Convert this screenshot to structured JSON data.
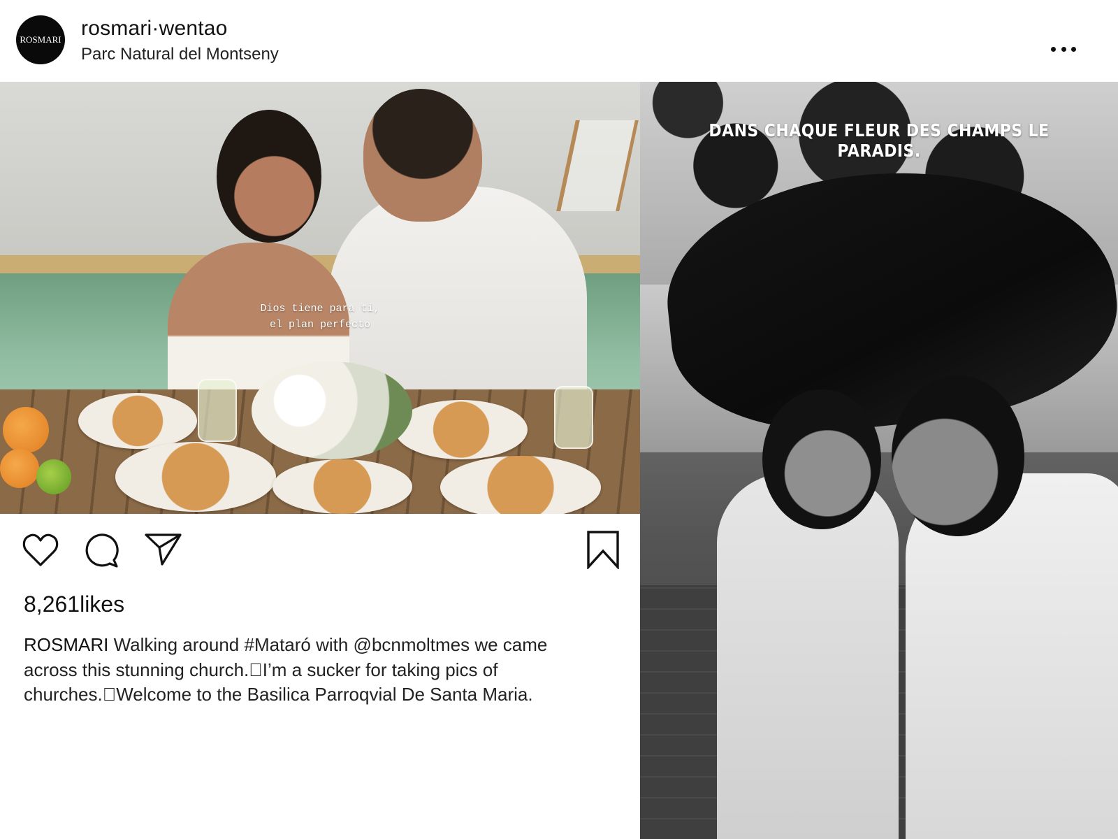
{
  "header": {
    "avatar_text": "ROSMARI",
    "username": "rosmari·wentao",
    "location": "Parc Natural del Montseny",
    "more_icon": "more-horizontal-icon"
  },
  "photos": {
    "left_overlay_line1": "Dios tiene para ti,",
    "left_overlay_line2": "el plan perfecto",
    "right_overlay": "DANS CHAQUE FLEUR DES CHAMPS LE PARADIS."
  },
  "actions": {
    "like_icon": "heart-icon",
    "comment_icon": "comment-icon",
    "share_icon": "send-icon",
    "save_icon": "bookmark-icon"
  },
  "post": {
    "likes_count": "8,261",
    "likes_label": "likes",
    "caption_user": "ROSMARI",
    "caption_text": "Walking around #Mataró with @bcnmoltmes we came across this stunning church.\u0000I’m a sucker for taking pics of churches.\u0000Welcome to the Basilica Parroqvial De Santa Maria."
  },
  "colors": {
    "text": "#111111",
    "background": "#ffffff",
    "avatar_bg": "#0a0a0a"
  }
}
